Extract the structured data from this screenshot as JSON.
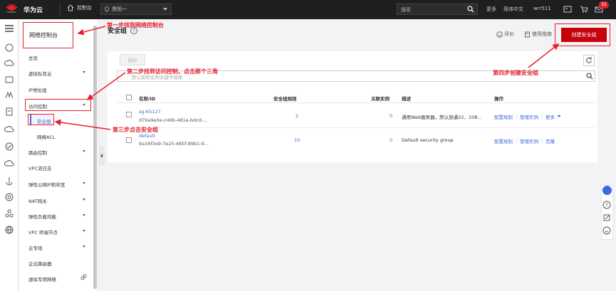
{
  "topbar": {
    "logo_text": "HUAWEI",
    "brand": "华为云",
    "console_label": "控制台",
    "region": "贵阳一",
    "search_placeholder": "搜索",
    "more": "更多",
    "language": "简体中文",
    "username": "wrr511",
    "message_count": "32"
  },
  "sidebar": {
    "title": "网络控制台",
    "items": [
      {
        "label": "总览"
      },
      {
        "label": "虚拟私有云"
      },
      {
        "label": "IP地址组"
      },
      {
        "label": "访问控制"
      },
      {
        "label": "安全组"
      },
      {
        "label": "网络ACL"
      },
      {
        "label": "路由控制"
      },
      {
        "label": "VPC流日志"
      },
      {
        "label": "弹性公网IP和带宽"
      },
      {
        "label": "NAT网关"
      },
      {
        "label": "弹性负载均衡"
      },
      {
        "label": "VPC 终端节点"
      },
      {
        "label": "云专线"
      },
      {
        "label": "企业路由器"
      },
      {
        "label": "虚拟专用网络"
      }
    ]
  },
  "page": {
    "title": "安全组",
    "feedback": "评价",
    "guide": "使用指南",
    "create_button": "创建安全组",
    "delete_button": "删除",
    "filter_placeholder": "默认按照名称关键字搜索"
  },
  "table": {
    "headers": [
      "名称/ID",
      "安全组规则",
      "关联实例",
      "描述",
      "操作"
    ],
    "rows": [
      {
        "name": "sg-KS127",
        "id": "d7ba9e0e-c46b-481e-bdcd-...",
        "rules": "2",
        "instances": "0",
        "description": "通用Web服务器，默认放通22、338...",
        "ops": [
          "配置规则",
          "管理实例",
          "更多"
        ]
      },
      {
        "name": "default",
        "id": "9a16f3e9-7e25-485f-89b1-9...",
        "rules": "10",
        "instances": "0",
        "description": "Default security group",
        "ops": [
          "配置规则",
          "管理实例",
          "克隆"
        ]
      }
    ]
  },
  "annotations": {
    "step1": "第一步找到网络控制台",
    "step2": "第二步找到访问控制，点击那个三角",
    "step3": "第三步点击安全组",
    "step4": "第四步创建安全组"
  },
  "colors": {
    "accent": "#c7000b",
    "annotation": "#e5202e",
    "link": "#3f6ad8",
    "topbar": "#1f1f1f"
  }
}
